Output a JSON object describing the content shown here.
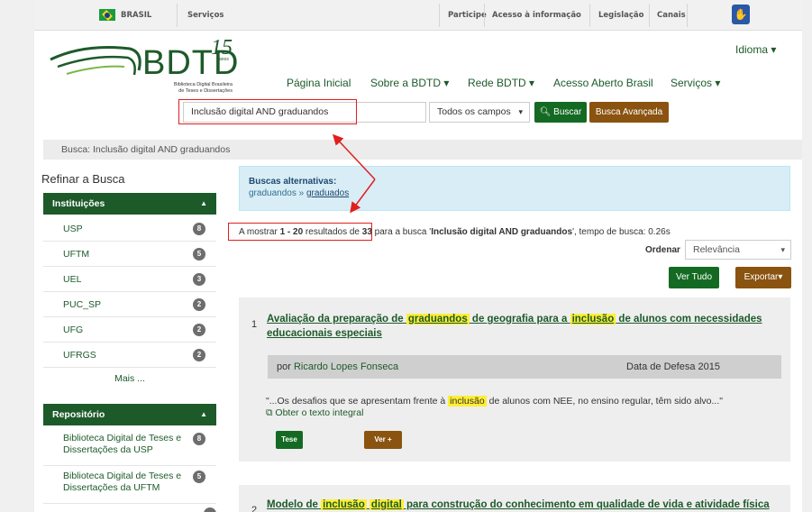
{
  "govbar": {
    "brasil": "BRASIL",
    "servicos": "Serviços",
    "participe": "Participe",
    "acesso_info": "Acesso à informação",
    "legislacao": "Legislação",
    "canais": "Canais"
  },
  "header": {
    "logo_text": "BDTD",
    "logo_15": "15",
    "logo_anos": "anos",
    "logo_sub_1": "Biblioteca Digital Brasileira",
    "logo_sub_2": "de Teses e Dissertações",
    "idioma": "Idioma ▾",
    "nav": [
      "Página Inicial",
      "Sobre a BDTD ▾",
      "Rede BDTD ▾",
      "Acesso Aberto Brasil",
      "Serviços ▾"
    ]
  },
  "search": {
    "query": "Inclusão digital AND  graduandos",
    "field": "Todos os campos",
    "buscar": "Buscar",
    "avancada": "Busca Avançada"
  },
  "breadcrumb": "Busca: Inclusão digital AND graduandos",
  "sidebar": {
    "refinar": "Refinar a Busca",
    "instituicoes_label": "Instituições",
    "instituicoes": [
      {
        "name": "USP",
        "count": "8"
      },
      {
        "name": "UFTM",
        "count": "5"
      },
      {
        "name": "UEL",
        "count": "3"
      },
      {
        "name": "PUC_SP",
        "count": "2"
      },
      {
        "name": "UFG",
        "count": "2"
      },
      {
        "name": "UFRGS",
        "count": "2"
      }
    ],
    "mais": "Mais ...",
    "repositorio_label": "Repositório",
    "repositorios": [
      {
        "name": "Biblioteca Digital de Teses e Dissertações da USP",
        "count": "8"
      },
      {
        "name": "Biblioteca Digital de Teses e Dissertações da UFTM",
        "count": "5"
      }
    ]
  },
  "alert": {
    "title": "Buscas alternativas:",
    "text_1": "graduandos » ",
    "link": "graduados"
  },
  "results": {
    "prefix": "A mostrar ",
    "range": "1 - 20",
    "mid": " resultados de ",
    "total": "33",
    "para": " para a busca '",
    "query": "Inclusão digital AND graduandos",
    "suffix": "', tempo de busca: 0.26s",
    "ordenar": "Ordenar",
    "sort": "Relevância",
    "ver_tudo": "Ver Tudo",
    "exportar": "Exportar▾"
  },
  "items": [
    {
      "num": "1",
      "t1": "Avaliação da preparação de ",
      "h1": "graduandos",
      "t2": " de geografia para a ",
      "h2": "inclusão",
      "t3": " de alunos com necessidades",
      "t4": "educacionais especiais",
      "por": "por ",
      "author": "Ricardo Lopes Fonseca",
      "defesa": "Data de Defesa 2015",
      "s1": "\"...Os desafios que se apresentam frente à ",
      "sh": "inclusão",
      "s2": " de alunos com NEE, no ensino regular, têm sido alvo...\"",
      "obter": "Obter o texto integral",
      "tese": "Tese",
      "ver": "Ver +"
    },
    {
      "num": "2",
      "t1": "Modelo de ",
      "h1": "inclusão",
      "t2": " ",
      "h2": "digital",
      "t3": " para construção do conhecimento em qualidade de vida e atividade física"
    }
  ]
}
